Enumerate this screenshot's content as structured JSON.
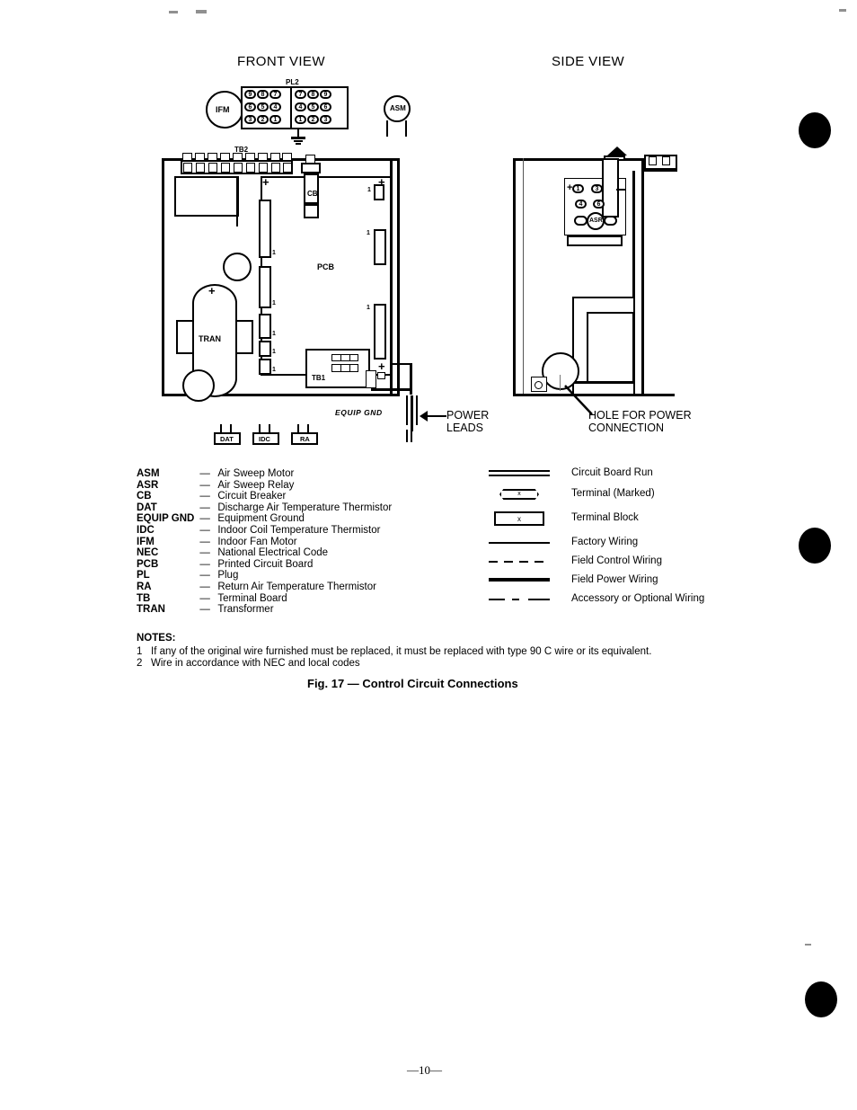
{
  "page": {
    "number": "—10—",
    "figure_caption": "Fig. 17  —  Control Circuit Connections"
  },
  "views": {
    "front_title": "FRONT VIEW",
    "side_title": "SIDE VIEW"
  },
  "front_view": {
    "motor_label": "IFM",
    "sweep_motor_label": "ASM",
    "plug_label": "PL2",
    "plug_rows_left": [
      [
        "9",
        "8",
        "7"
      ],
      [
        "6",
        "5",
        "4"
      ],
      [
        "3",
        "2",
        "1"
      ]
    ],
    "plug_rows_right": [
      [
        "7",
        "8",
        "9"
      ],
      [
        "4",
        "5",
        "6"
      ],
      [
        "1",
        "2",
        "3"
      ]
    ],
    "terminal_board_top": "TB2",
    "terminal_board_bottom": "TB1",
    "breaker_label": "CB",
    "board_label": "PCB",
    "transformer_label": "TRAN",
    "pin_marker": "1",
    "equip_gnd_label": "EQUIP GND",
    "power_leads_label": "POWER\nLEADS",
    "thermistors": [
      "DAT",
      "IDC",
      "RA"
    ]
  },
  "side_view": {
    "relay_label": "ASR",
    "terminals": [
      "1",
      "3",
      "4",
      "6"
    ],
    "hole_callout": "HOLE FOR POWER\nCONNECTION"
  },
  "abbreviations": {
    "dash": "—",
    "items": [
      {
        "code": "ASM",
        "text": "Air Sweep Motor"
      },
      {
        "code": "ASR",
        "text": "Air Sweep Relay"
      },
      {
        "code": "CB",
        "text": "Circuit Breaker"
      },
      {
        "code": "DAT",
        "text": "Discharge Air Temperature Thermistor"
      },
      {
        "code": "EQUIP GND",
        "text": "Equipment Ground"
      },
      {
        "code": "IDC",
        "text": "Indoor Coil Temperature Thermistor"
      },
      {
        "code": "IFM",
        "text": "Indoor Fan Motor"
      },
      {
        "code": "NEC",
        "text": "National Electrical Code"
      },
      {
        "code": "PCB",
        "text": "Printed Circuit Board"
      },
      {
        "code": "PL",
        "text": "Plug"
      },
      {
        "code": "RA",
        "text": "Return Air Temperature Thermistor"
      },
      {
        "code": "TB",
        "text": "Terminal Board"
      },
      {
        "code": "TRAN",
        "text": "Transformer"
      }
    ]
  },
  "symbol_legend": {
    "marker": "x",
    "items": [
      {
        "symbol": "circuit-board-run",
        "label": "Circuit Board Run"
      },
      {
        "symbol": "terminal-marked",
        "label": "Terminal (Marked)"
      },
      {
        "symbol": "terminal-block",
        "label": "Terminal Block"
      },
      {
        "symbol": "factory-wiring",
        "label": "Factory Wiring"
      },
      {
        "symbol": "field-control-wiring",
        "label": "Field Control Wiring"
      },
      {
        "symbol": "field-power-wiring",
        "label": "Field Power Wiring"
      },
      {
        "symbol": "accessory-optional-wiring",
        "label": "Accessory or Optional Wiring"
      }
    ]
  },
  "notes": {
    "title": "NOTES:",
    "items": [
      {
        "num": "1",
        "text": "If any of the original wire furnished must be replaced, it must be replaced with type 90 C wire or its equivalent."
      },
      {
        "num": "2",
        "text": "Wire in accordance with NEC and local codes"
      }
    ]
  }
}
